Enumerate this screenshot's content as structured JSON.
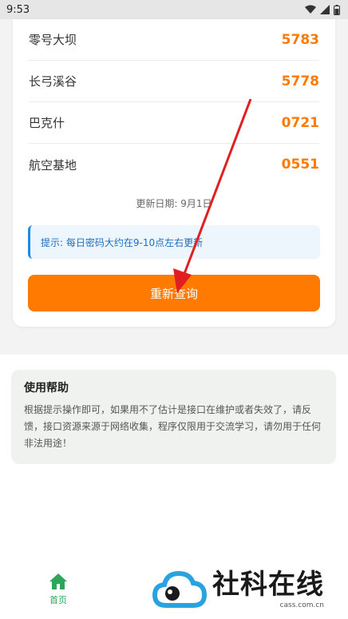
{
  "status_bar": {
    "time": "9:53"
  },
  "codes": [
    {
      "name": "零号大坝",
      "value": "5783"
    },
    {
      "name": "长弓溪谷",
      "value": "5778"
    },
    {
      "name": "巴克什",
      "value": "0721"
    },
    {
      "name": "航空基地",
      "value": "0551"
    }
  ],
  "update_date": "更新日期: 9月1日",
  "tip": "提示: 每日密码大约在9-10点左右更新",
  "requery_label": "重新查询",
  "help": {
    "title": "使用帮助",
    "text": "根据提示操作即可，如果用不了估计是接口在维护或者失效了，请反馈，接口资源来源于网络收集，程序仅限用于交流学习，请勿用于任何非法用途！"
  },
  "nav": {
    "home_label": "首页"
  },
  "watermark": {
    "title": "社科在线",
    "subtitle": "cass.com.cn"
  },
  "colors": {
    "accent": "#ff7a00",
    "tip_blue": "#1e88e5",
    "nav_green": "#2ea65a",
    "arrow_red": "#e02020"
  }
}
